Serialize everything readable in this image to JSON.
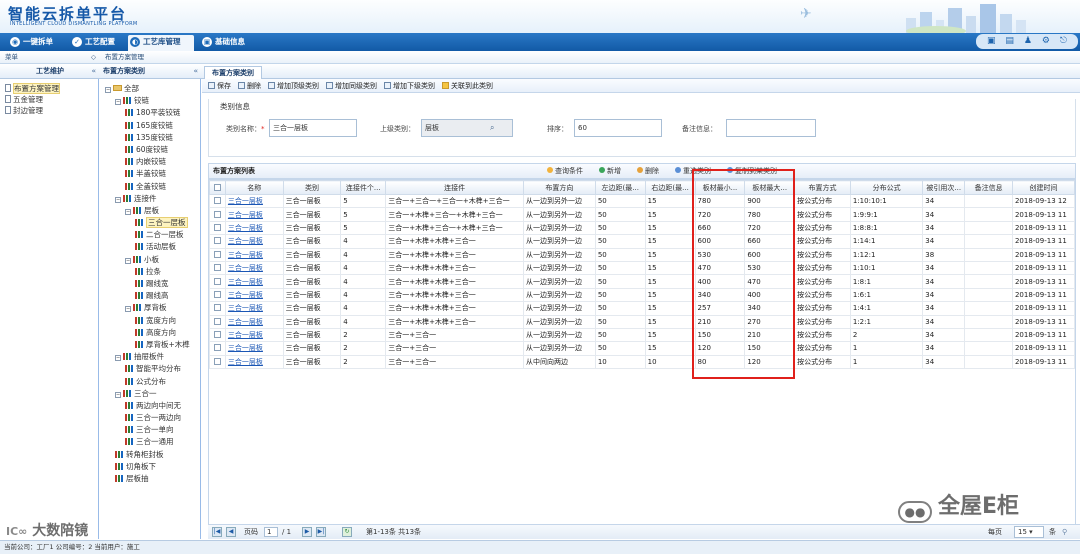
{
  "app": {
    "title": "智能云拆单平台",
    "subtitle": "INTELLIGENT CLOUD DISMANTLING PLATFORM"
  },
  "nav": {
    "items": [
      "一键拆单",
      "工艺配置",
      "工艺库管理",
      "基础信息"
    ],
    "active": 2,
    "tool_icons": [
      "monitor-icon",
      "book-icon",
      "user-icon",
      "gear-icon",
      "exit-icon"
    ]
  },
  "panels": {
    "menu_label": "菜单",
    "menu_title": "工艺维护",
    "menu_collapse": "«",
    "tab1": "布置方案管理",
    "tree_title": "布置方案类别",
    "tree_collapse": "«",
    "tab2": "布置方案类别"
  },
  "menu": {
    "items": [
      "布置方案管理",
      "五金管理",
      "封边管理"
    ],
    "selected": 0
  },
  "tree": [
    {
      "label": "全部",
      "level": 0,
      "type": "folder",
      "toggle": "⊟"
    },
    {
      "label": "铰链",
      "level": 1,
      "type": "bar",
      "toggle": "⊟"
    },
    {
      "label": "180平装铰链",
      "level": 2,
      "type": "bar"
    },
    {
      "label": "165度铰链",
      "level": 2,
      "type": "bar"
    },
    {
      "label": "135度铰链",
      "level": 2,
      "type": "bar"
    },
    {
      "label": "60度铰链",
      "level": 2,
      "type": "bar"
    },
    {
      "label": "内嵌铰链",
      "level": 2,
      "type": "bar"
    },
    {
      "label": "半盖铰链",
      "level": 2,
      "type": "bar"
    },
    {
      "label": "全盖铰链",
      "level": 2,
      "type": "bar"
    },
    {
      "label": "连接件",
      "level": 1,
      "type": "bar",
      "toggle": "⊟"
    },
    {
      "label": "层板",
      "level": 2,
      "type": "bar",
      "toggle": "⊟"
    },
    {
      "label": "三合一层板",
      "level": 3,
      "type": "bar",
      "selected": true
    },
    {
      "label": "二合一层板",
      "level": 3,
      "type": "bar"
    },
    {
      "label": "活动层板",
      "level": 3,
      "type": "bar"
    },
    {
      "label": "小板",
      "level": 2,
      "type": "bar",
      "toggle": "⊟"
    },
    {
      "label": "拉条",
      "level": 3,
      "type": "bar"
    },
    {
      "label": "踢线宽",
      "level": 3,
      "type": "bar"
    },
    {
      "label": "踢线高",
      "level": 3,
      "type": "bar"
    },
    {
      "label": "厚背板",
      "level": 2,
      "type": "bar",
      "toggle": "⊟"
    },
    {
      "label": "宽度方向",
      "level": 3,
      "type": "bar"
    },
    {
      "label": "高度方向",
      "level": 3,
      "type": "bar"
    },
    {
      "label": "厚背板+木榫",
      "level": 3,
      "type": "bar"
    },
    {
      "label": "抽屉板件",
      "level": 1,
      "type": "bar",
      "toggle": "⊟"
    },
    {
      "label": "智能平均分布",
      "level": 2,
      "type": "bar"
    },
    {
      "label": "公式分布",
      "level": 2,
      "type": "bar"
    },
    {
      "label": "三合一",
      "level": 1,
      "type": "bar",
      "toggle": "⊟"
    },
    {
      "label": "两边向中间无",
      "level": 2,
      "type": "bar"
    },
    {
      "label": "三合一两边向",
      "level": 2,
      "type": "bar"
    },
    {
      "label": "三合一单向",
      "level": 2,
      "type": "bar"
    },
    {
      "label": "三合一通用",
      "level": 2,
      "type": "bar"
    },
    {
      "label": "转角柜封板",
      "level": 1,
      "type": "bar"
    },
    {
      "label": "切角板下",
      "level": 1,
      "type": "bar"
    },
    {
      "label": "层板抽",
      "level": 1,
      "type": "bar"
    }
  ],
  "toolbar": [
    "保存",
    "删除",
    "增加顶级类别",
    "增加同级类别",
    "增加下级类别",
    "关联到此类别"
  ],
  "form": {
    "section_title": "类别信息",
    "name_label": "类别名称：",
    "required_mark": "*",
    "name_value": "三合一层板",
    "parent_label": "上级类别：",
    "parent_value": "层板",
    "sort_label": "排序：",
    "sort_value": "60",
    "remark_label": "备注信息：",
    "remark_value": ""
  },
  "list": {
    "title": "布置方案列表",
    "tools": [
      {
        "label": "查询条件",
        "color": "#f2b33d"
      },
      {
        "label": "新增",
        "color": "#3aa55a"
      },
      {
        "label": "删除",
        "color": "#e6a23c"
      },
      {
        "label": "重选类别",
        "color": "#5b8fd6"
      },
      {
        "label": "复制到某类别",
        "color": "#5b8fd6"
      }
    ]
  },
  "table": {
    "columns": [
      "名称",
      "类别",
      "连接件个...",
      "连接件",
      "布置方向",
      "左边距(最...",
      "右边距(最...",
      "板材最小...",
      "板材最大...",
      "布置方式",
      "分布公式",
      "被引用次...",
      "备注信息",
      "创建时间"
    ],
    "rows": [
      [
        "三合一层板",
        "三合一层板",
        "5",
        "三合一+三合一+三合一+木榫+三合一",
        "从一边到另外一边",
        "50",
        "15",
        "780",
        "900",
        "按公式分布",
        "1:10:10:1",
        "34",
        "",
        "2018-09-13 12"
      ],
      [
        "三合一层板",
        "三合一层板",
        "5",
        "三合一+木榫+三合一+木榫+三合一",
        "从一边到另外一边",
        "50",
        "15",
        "720",
        "780",
        "按公式分布",
        "1:9:9:1",
        "34",
        "",
        "2018-09-13 11"
      ],
      [
        "三合一层板",
        "三合一层板",
        "5",
        "三合一+木榫+三合一+木榫+三合一",
        "从一边到另外一边",
        "50",
        "15",
        "660",
        "720",
        "按公式分布",
        "1:8:8:1",
        "34",
        "",
        "2018-09-13 11"
      ],
      [
        "三合一层板",
        "三合一层板",
        "4",
        "三合一+木榫+木榫+三合一",
        "从一边到另外一边",
        "50",
        "15",
        "600",
        "660",
        "按公式分布",
        "1:14:1",
        "34",
        "",
        "2018-09-13 11"
      ],
      [
        "三合一层板",
        "三合一层板",
        "4",
        "三合一+木榫+木榫+三合一",
        "从一边到另外一边",
        "50",
        "15",
        "530",
        "600",
        "按公式分布",
        "1:12:1",
        "38",
        "",
        "2018-09-13 11"
      ],
      [
        "三合一层板",
        "三合一层板",
        "4",
        "三合一+木榫+木榫+三合一",
        "从一边到另外一边",
        "50",
        "15",
        "470",
        "530",
        "按公式分布",
        "1:10:1",
        "34",
        "",
        "2018-09-13 11"
      ],
      [
        "三合一层板",
        "三合一层板",
        "4",
        "三合一+木榫+木榫+三合一",
        "从一边到另外一边",
        "50",
        "15",
        "400",
        "470",
        "按公式分布",
        "1:8:1",
        "34",
        "",
        "2018-09-13 11"
      ],
      [
        "三合一层板",
        "三合一层板",
        "4",
        "三合一+木榫+木榫+三合一",
        "从一边到另外一边",
        "50",
        "15",
        "340",
        "400",
        "按公式分布",
        "1:6:1",
        "34",
        "",
        "2018-09-13 11"
      ],
      [
        "三合一层板",
        "三合一层板",
        "4",
        "三合一+木榫+木榫+三合一",
        "从一边到另外一边",
        "50",
        "15",
        "257",
        "340",
        "按公式分布",
        "1:4:1",
        "34",
        "",
        "2018-09-13 11"
      ],
      [
        "三合一层板",
        "三合一层板",
        "4",
        "三合一+木榫+木榫+三合一",
        "从一边到另外一边",
        "50",
        "15",
        "210",
        "270",
        "按公式分布",
        "1:2:1",
        "34",
        "",
        "2018-09-13 11"
      ],
      [
        "三合一层板",
        "三合一层板",
        "2",
        "三合一+三合一",
        "从一边到另外一边",
        "50",
        "15",
        "150",
        "210",
        "按公式分布",
        "2",
        "34",
        "",
        "2018-09-13 11"
      ],
      [
        "三合一层板",
        "三合一层板",
        "2",
        "三合一+三合一",
        "从一边到另外一边",
        "50",
        "15",
        "120",
        "150",
        "按公式分布",
        "1",
        "34",
        "",
        "2018-09-13 11"
      ],
      [
        "三合一层板",
        "三合一层板",
        "2",
        "三合一+三合一",
        "从中间向两边",
        "10",
        "10",
        "80",
        "120",
        "按公式分布",
        "1",
        "34",
        "",
        "2018-09-13 11"
      ]
    ]
  },
  "pager": {
    "page_label": "页码",
    "page": "1",
    "total": "/ 1",
    "summary": "第1-13条  共13条",
    "per_page_label": "每页",
    "per_page": "15"
  },
  "status": "当前公司：工厂1   公司编号：2   当前用户：施工",
  "watermarks": {
    "left": "大数陪镜",
    "right": "全屋E柜"
  },
  "colors": {
    "highlight": "#e0201b",
    "nav": "#1f6cb9",
    "link": "#1a56b5"
  }
}
